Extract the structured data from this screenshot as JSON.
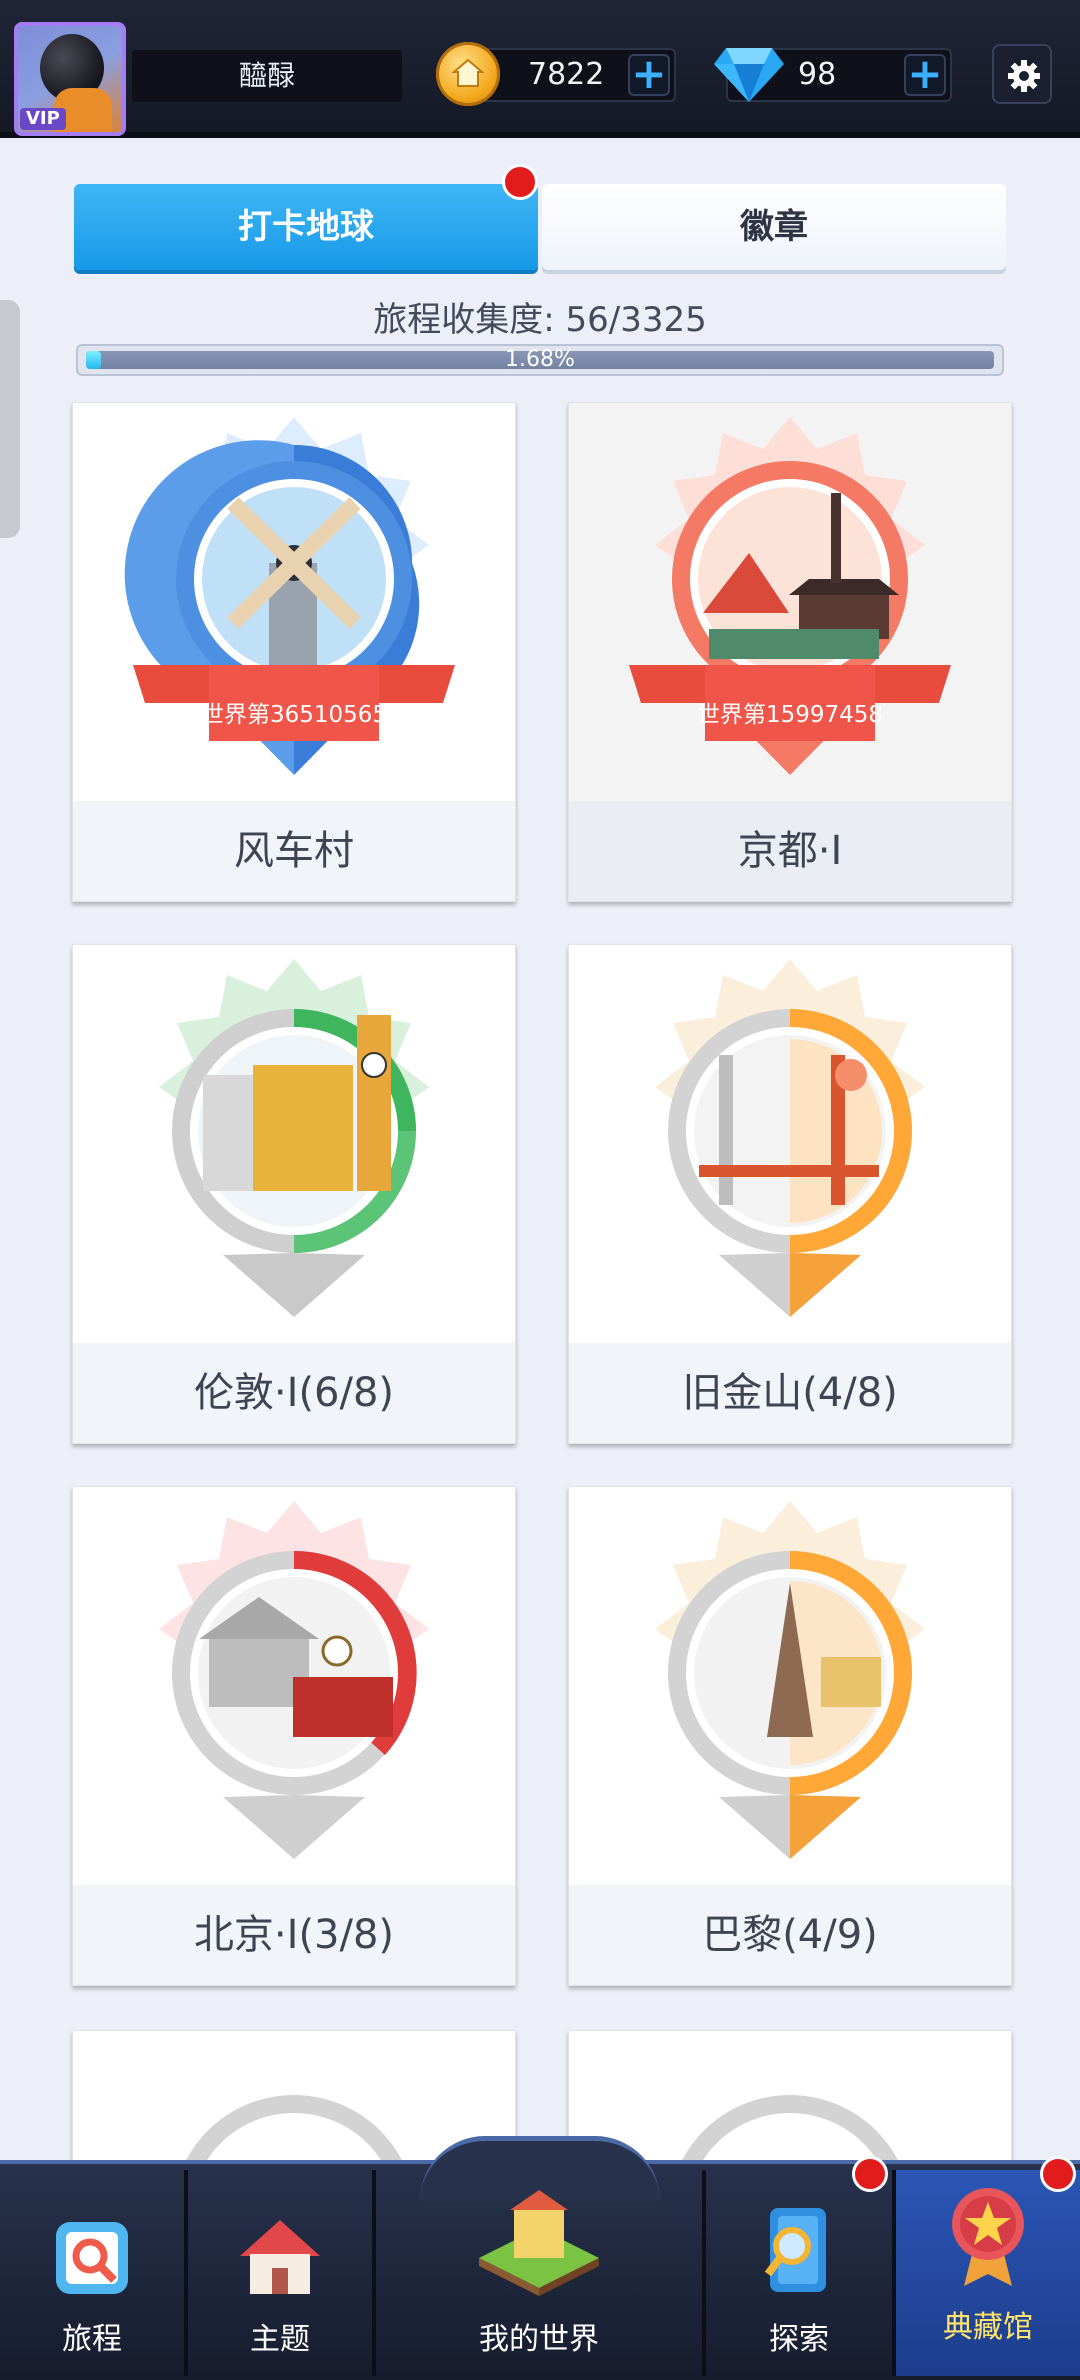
{
  "header": {
    "username": "醯醁",
    "coins": "7822",
    "gems": "98",
    "vip_badge": "VIP"
  },
  "tabs": [
    {
      "label": "打卡地球",
      "active": true
    },
    {
      "label": "徽章",
      "active": false
    }
  ],
  "progress": {
    "title": "旅程收集度: 56/3325",
    "percent_text": "1.68%",
    "value": 0.0168
  },
  "cards": [
    {
      "name": "风车村",
      "rank": "世界第36510565",
      "theme": "blue"
    },
    {
      "name": "京都·I",
      "rank": "世界第15997458",
      "theme": "salmon"
    },
    {
      "name": "伦敦·I(6/8)",
      "theme": "green"
    },
    {
      "name": "旧金山(4/8)",
      "theme": "orange"
    },
    {
      "name": "北京·I(3/8)",
      "theme": "red"
    },
    {
      "name": "巴黎(4/9)",
      "theme": "orange"
    }
  ],
  "nav": {
    "items": [
      {
        "label": "旅程",
        "icon": "journey-icon"
      },
      {
        "label": "主题",
        "icon": "house-icon"
      },
      {
        "label": "我的世界",
        "icon": "world-block-icon"
      },
      {
        "label": "探索",
        "icon": "magnifier-icon"
      },
      {
        "label": "典藏馆",
        "icon": "medal-icon"
      }
    ]
  },
  "colors": {
    "accent": "#1ea0ec",
    "nav_bg": "#1c2438",
    "badge_red": "#e21c1c"
  }
}
